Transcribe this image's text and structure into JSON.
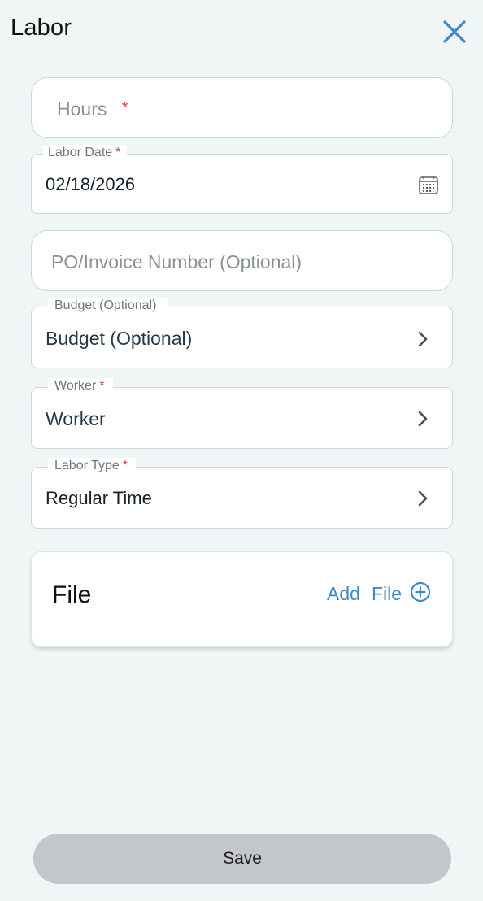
{
  "header": {
    "title": "Labor",
    "close_icon": "close-icon"
  },
  "form": {
    "hours": {
      "placeholder": "Hours",
      "required_mark": "*"
    },
    "labor_date": {
      "label": "Labor Date",
      "required_mark": "*",
      "value": "02/18/2026",
      "icon": "calendar-icon"
    },
    "po_invoice": {
      "placeholder": "PO/Invoice Number (Optional)"
    },
    "budget": {
      "label": "Budget (Optional)",
      "value": "Budget (Optional)",
      "icon": "chevron-right-icon"
    },
    "worker": {
      "label": "Worker",
      "required_mark": "*",
      "value": "Worker",
      "icon": "chevron-right-icon"
    },
    "labor_type": {
      "label": "Labor Type",
      "required_mark": "*",
      "value": "Regular Time",
      "icon": "chevron-right-icon"
    }
  },
  "file_section": {
    "title": "File",
    "add_word1": "Add",
    "add_word2": "File",
    "add_icon": "plus-circle-icon"
  },
  "footer": {
    "save_label": "Save"
  },
  "colors": {
    "background": "#f0f5f5",
    "accent": "#3f88c5",
    "required": "#d9463b",
    "save_disabled": "#c4c7c9"
  }
}
